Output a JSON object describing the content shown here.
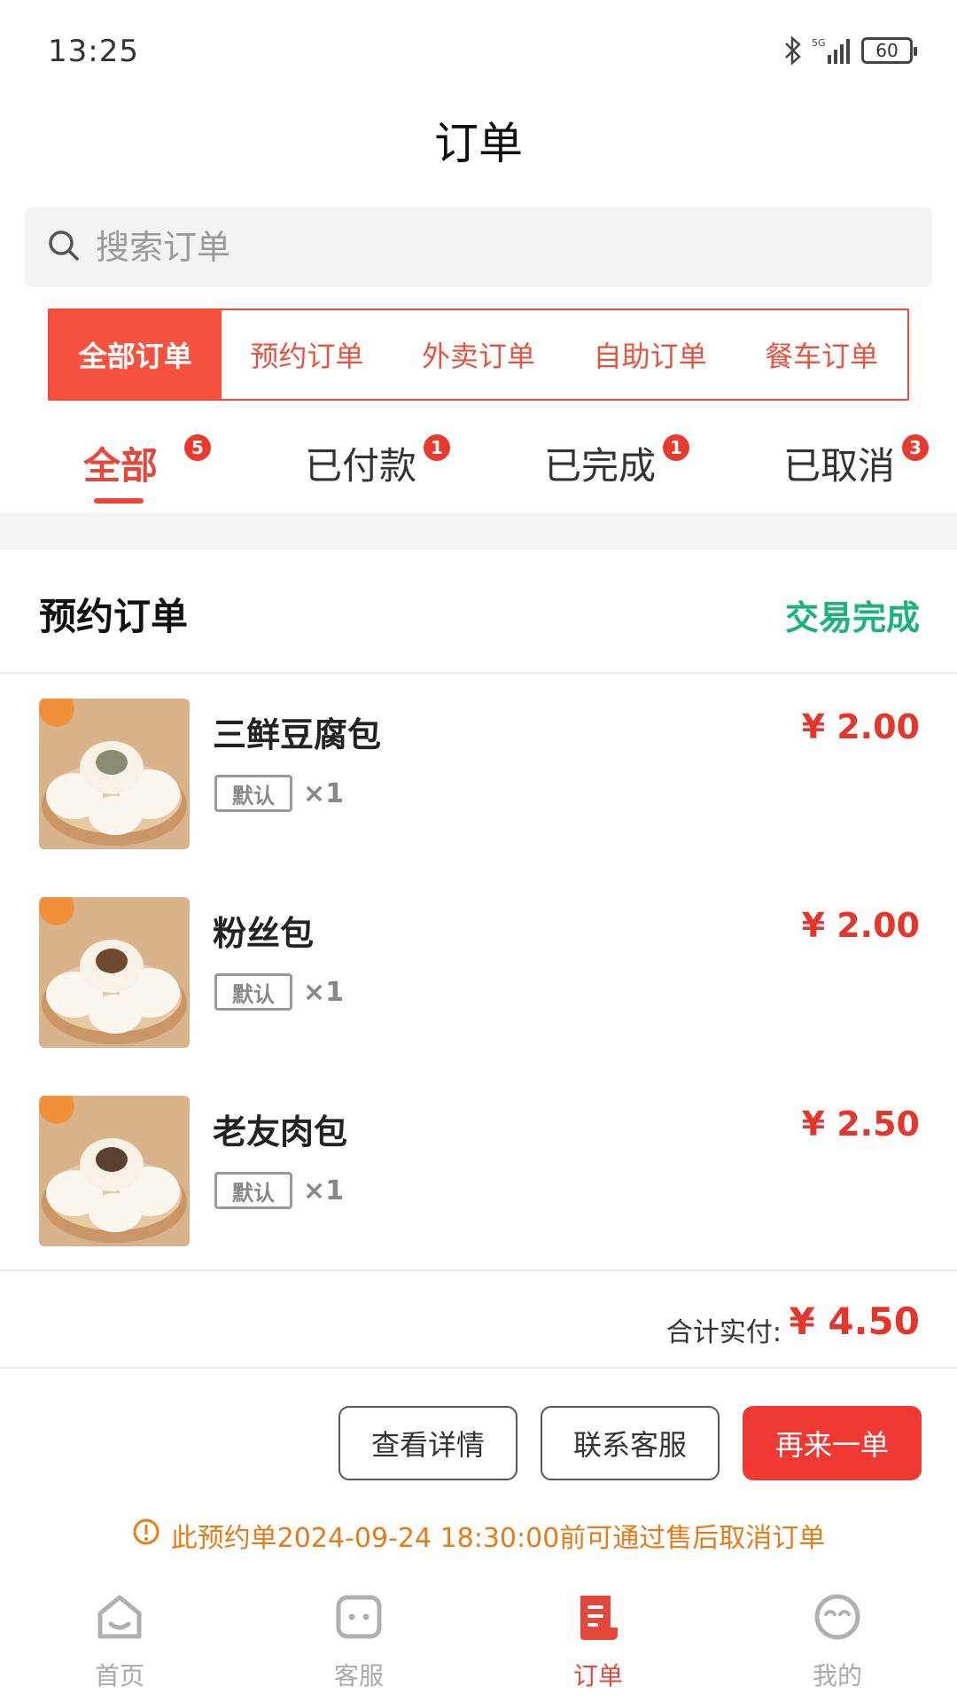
{
  "status_bar": {
    "time": "13:25",
    "battery": "60",
    "network": "5G"
  },
  "header": {
    "title": "订单"
  },
  "search": {
    "placeholder": "搜索订单"
  },
  "type_tabs": [
    {
      "label": "全部订单",
      "active": true
    },
    {
      "label": "预约订单",
      "active": false
    },
    {
      "label": "外卖订单",
      "active": false
    },
    {
      "label": "自助订单",
      "active": false
    },
    {
      "label": "餐车订单",
      "active": false
    }
  ],
  "status_tabs": [
    {
      "label": "全部",
      "badge": "5",
      "active": true
    },
    {
      "label": "已付款",
      "badge": "1",
      "active": false
    },
    {
      "label": "已完成",
      "badge": "1",
      "active": false
    },
    {
      "label": "已取消",
      "badge": "3",
      "active": false
    }
  ],
  "order": {
    "type": "预约订单",
    "status": "交易完成",
    "items": [
      {
        "name": "三鲜豆腐包",
        "tag": "默认",
        "qty": "×1",
        "price": "¥ 2.00"
      },
      {
        "name": "粉丝包",
        "tag": "默认",
        "qty": "×1",
        "price": "¥ 2.00"
      },
      {
        "name": "老友肉包",
        "tag": "默认",
        "qty": "×1",
        "price": "¥ 2.50"
      }
    ],
    "total_label": "合计实付:",
    "total_value": "¥ 4.50",
    "buttons": {
      "details": "查看详情",
      "contact": "联系客服",
      "reorder": "再来一单"
    },
    "notice": "此预约单2024-09-24 18:30:00前可通过售后取消订单"
  },
  "bottom_nav": [
    {
      "label": "首页",
      "icon": "home-icon",
      "active": false
    },
    {
      "label": "客服",
      "icon": "chat-icon",
      "active": false
    },
    {
      "label": "订单",
      "icon": "order-icon",
      "active": true
    },
    {
      "label": "我的",
      "icon": "profile-icon",
      "active": false
    }
  ],
  "colors": {
    "accent": "#e5473a",
    "success": "#1bb37a",
    "warning": "#e87a18"
  }
}
